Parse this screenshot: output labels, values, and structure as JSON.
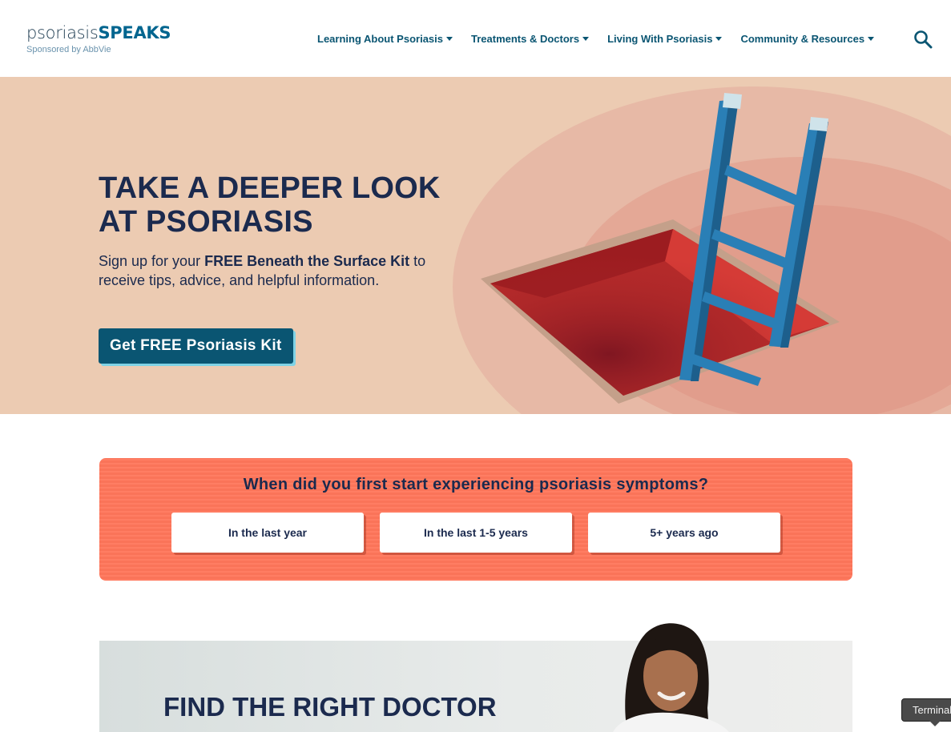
{
  "header": {
    "logo_light": "psoriasis",
    "logo_bold": "SPEAKS",
    "logo_sub": "Sponsored by AbbVie",
    "nav": [
      {
        "label": "Learning About Psoriasis"
      },
      {
        "label": "Treatments & Doctors"
      },
      {
        "label": "Living With Psoriasis"
      },
      {
        "label": "Community & Resources"
      }
    ],
    "search_icon": "search-icon"
  },
  "hero": {
    "title": "TAKE A DEEPER LOOK AT PSORIASIS",
    "text_pre": "Sign up for your ",
    "text_bold": "FREE Beneath the Surface Kit",
    "text_post": " to receive tips, advice, and helpful information.",
    "cta": "Get FREE Psoriasis Kit"
  },
  "quiz": {
    "question": "When did you first start experiencing psoriasis symptoms?",
    "options": [
      {
        "label": "In the last year"
      },
      {
        "label": "In the last 1-5 years"
      },
      {
        "label": "5+ years ago"
      }
    ]
  },
  "doctor": {
    "title": "FIND THE RIGHT DOCTOR"
  },
  "tooltip": {
    "text": "Terminal"
  },
  "colors": {
    "navy": "#1b2a4e",
    "teal": "#0a5572",
    "hero_bg": "#eccbb2",
    "quiz_bg": "#ff765b",
    "accent_light_blue": "#7fd3e6"
  }
}
